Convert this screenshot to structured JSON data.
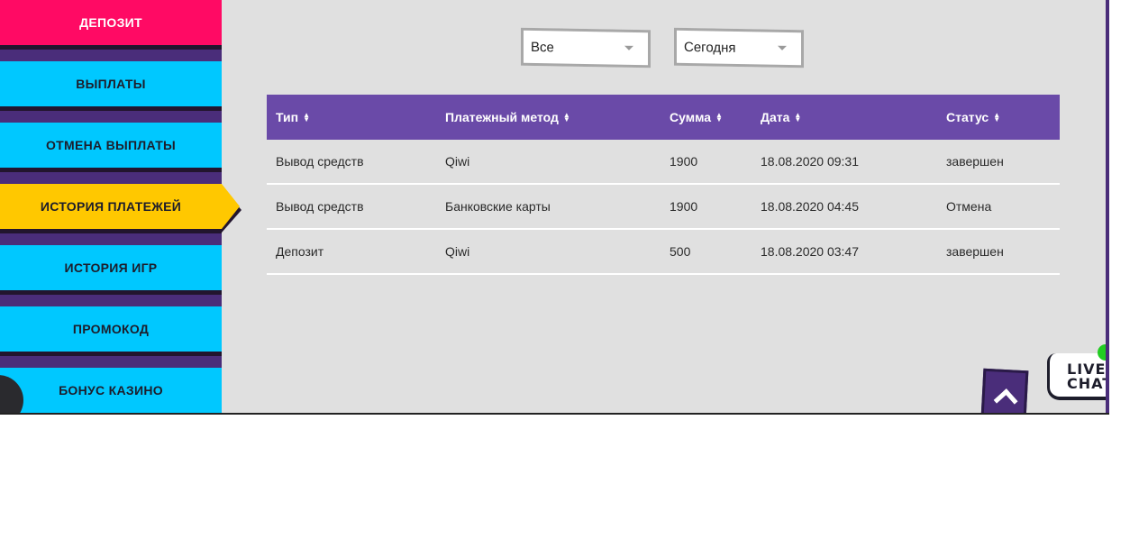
{
  "sidebar": {
    "items": [
      {
        "label": "ДЕПОЗИТ",
        "style": "pink"
      },
      {
        "label": "ВЫПЛАТЫ",
        "style": "cyan"
      },
      {
        "label": "ОТМЕНА ВЫПЛАТЫ",
        "style": "cyan"
      },
      {
        "label": "ИСТОРИЯ ПЛАТЕЖЕЙ",
        "style": "yellow",
        "active": true
      },
      {
        "label": "ИСТОРИЯ ИГР",
        "style": "cyan"
      },
      {
        "label": "ПРОМОКОД",
        "style": "cyan"
      },
      {
        "label": "БОНУС КАЗИНО",
        "style": "cyan"
      }
    ]
  },
  "filters": {
    "type_select": "Все",
    "period_select": "Сегодня"
  },
  "table": {
    "headers": [
      "Тип",
      "Платежный метод",
      "Сумма",
      "Дата",
      "Статус"
    ],
    "rows": [
      [
        "Вывод средств",
        "Qiwi",
        "1900",
        "18.08.2020 09:31",
        "завершен"
      ],
      [
        "Вывод средств",
        "Банковские карты",
        "1900",
        "18.08.2020 04:45",
        "Отмена"
      ],
      [
        "Депозит",
        "Qiwi",
        "500",
        "18.08.2020 03:47",
        "завершен"
      ]
    ]
  },
  "live_chat": {
    "line1": "LIVE",
    "line2": "CHAT"
  },
  "colors": {
    "accent_purple": "#6a4aa8",
    "pink": "#ff0a64",
    "cyan": "#00c8ff",
    "yellow": "#ffc800",
    "online": "#22cc22"
  },
  "icons": {
    "sort": "sort-icon",
    "dropdown": "chevron-down-icon",
    "scroll_top": "chevron-up-icon"
  }
}
